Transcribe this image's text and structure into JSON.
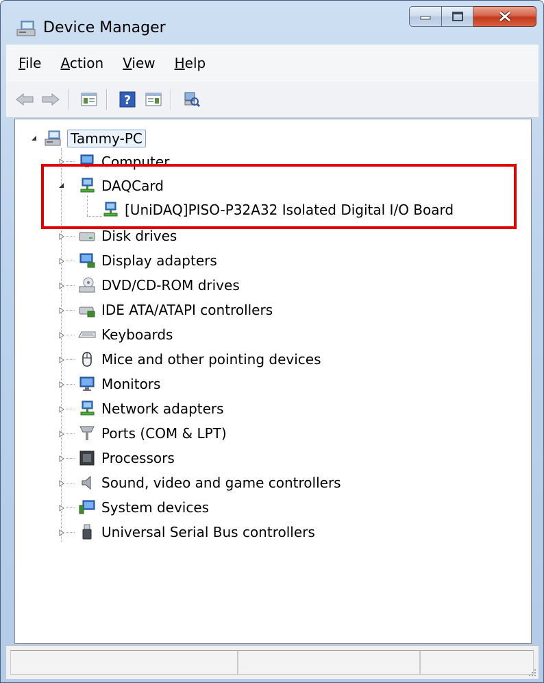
{
  "window": {
    "title": "Device Manager",
    "title_icon": "device-manager-icon"
  },
  "caption_buttons": [
    "minimize-icon",
    "maximize-icon",
    "close-icon"
  ],
  "menu": [
    {
      "label_acc": "F",
      "label_rest": "ile"
    },
    {
      "label_acc": "A",
      "label_rest": "ction"
    },
    {
      "label_acc": "V",
      "label_rest": "iew"
    },
    {
      "label_acc": "H",
      "label_rest": "elp"
    }
  ],
  "toolbar": [
    "back-arrow-icon",
    "forward-arrow-icon",
    "show-hide-console-tree-icon",
    "help-icon",
    "properties-icon",
    "scan-hardware-icon"
  ],
  "tree": {
    "root": {
      "label": "Tammy-PC",
      "icon": "computer-icon",
      "expanded": true
    },
    "items": [
      {
        "label": "Computer",
        "icon": "computer-icon",
        "expanded": false
      },
      {
        "label": "DAQCard",
        "icon": "network-icon",
        "expanded": true,
        "children": [
          {
            "label": "[UniDAQ]PISO-P32A32 Isolated Digital I/O Board",
            "icon": "network-icon"
          }
        ]
      },
      {
        "label": "Disk drives",
        "icon": "disk-drive-icon",
        "expanded": false
      },
      {
        "label": "Display adapters",
        "icon": "display-adapter-icon",
        "expanded": false
      },
      {
        "label": "DVD/CD-ROM drives",
        "icon": "dvd-drive-icon",
        "expanded": false
      },
      {
        "label": "IDE ATA/ATAPI controllers",
        "icon": "ide-controller-icon",
        "expanded": false
      },
      {
        "label": "Keyboards",
        "icon": "keyboard-icon",
        "expanded": false
      },
      {
        "label": "Mice and other pointing devices",
        "icon": "mouse-icon",
        "expanded": false
      },
      {
        "label": "Monitors",
        "icon": "monitor-icon",
        "expanded": false
      },
      {
        "label": "Network adapters",
        "icon": "network-icon",
        "expanded": false
      },
      {
        "label": "Ports (COM & LPT)",
        "icon": "port-icon",
        "expanded": false
      },
      {
        "label": "Processors",
        "icon": "processor-icon",
        "expanded": false
      },
      {
        "label": "Sound, video and game controllers",
        "icon": "speaker-icon",
        "expanded": false
      },
      {
        "label": "System devices",
        "icon": "system-devices-icon",
        "expanded": false
      },
      {
        "label": "Universal Serial Bus controllers",
        "icon": "usb-icon",
        "expanded": false
      }
    ]
  },
  "annotation": {
    "color": "#e00000"
  }
}
